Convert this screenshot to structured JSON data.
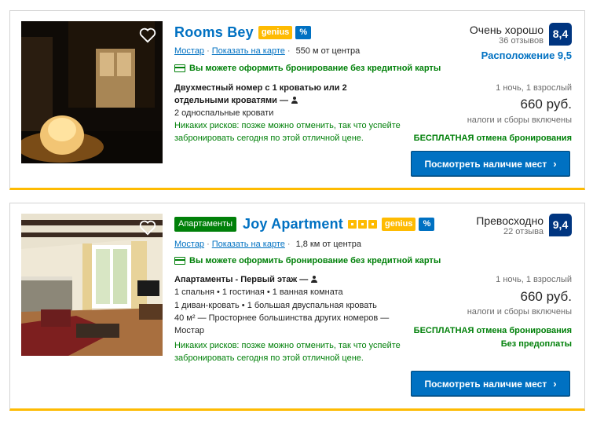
{
  "listings": [
    {
      "name": "Rooms Bey",
      "genius": "genius",
      "deal_badge": "%",
      "location_link": "Мостар",
      "map_link": "Показать на карте",
      "distance": "550 м от центра",
      "no_credit_card": "Вы можете оформить бронирование без кредитной карты",
      "room_name": "Двухместный номер с 1 кроватью или 2 отдельными кроватями",
      "room_dash": "—",
      "room_details": [
        "2 односпальные кровати"
      ],
      "no_risk": "Никаких рисков: позже можно отменить, так что успейте забронировать сегодня по этой отличной цене.",
      "score_label": "Очень хорошо",
      "reviews": "36 отзывов",
      "score": "8,4",
      "location_score": "Расположение 9,5",
      "price_for": "1 ночь, 1 взрослый",
      "price": "660 руб.",
      "taxes": "налоги и сборы включены",
      "free_cancel": "БЕСПЛАТНАЯ отмена бронирования",
      "cta": "Посмотреть наличие мест",
      "photo_colors": [
        "#0f0b07",
        "#f2c574",
        "#8a5a22"
      ]
    },
    {
      "name": "Joy Apartment",
      "type_badge": "Апартаменты",
      "stars": 3,
      "genius": "genius",
      "deal_badge": "%",
      "location_link": "Мостар",
      "map_link": "Показать на карте",
      "distance": "1,8 км от центра",
      "no_credit_card": "Вы можете оформить бронирование без кредитной карты",
      "room_name": "Апартаменты - Первый этаж",
      "room_dash": "—",
      "room_details": [
        "1 спальня • 1 гостиная • 1 ванная комната",
        "1 диван-кровать • 1 большая двуспальная кровать",
        "40 м² — Просторнее большинства других номеров — Мостар"
      ],
      "no_risk": "Никаких рисков: позже можно отменить, так что успейте забронировать сегодня по этой отличной цене.",
      "score_label": "Превосходно",
      "reviews": "22 отзыва",
      "score": "9,4",
      "price_for": "1 ночь, 1 взрослый",
      "price": "660 руб.",
      "taxes": "налоги и сборы включены",
      "free_cancel": "БЕСПЛАТНАЯ отмена бронирования",
      "no_prepay": "Без предоплаты",
      "cta": "Посмотреть наличие мест",
      "photo_colors": [
        "#f1ead9",
        "#3b2a20",
        "#a86f3f",
        "#6b1e1e"
      ]
    }
  ],
  "colors": {
    "brand_blue": "#0071c2",
    "score_blue": "#003580",
    "green": "#008009",
    "genius_yellow": "#febb02"
  }
}
